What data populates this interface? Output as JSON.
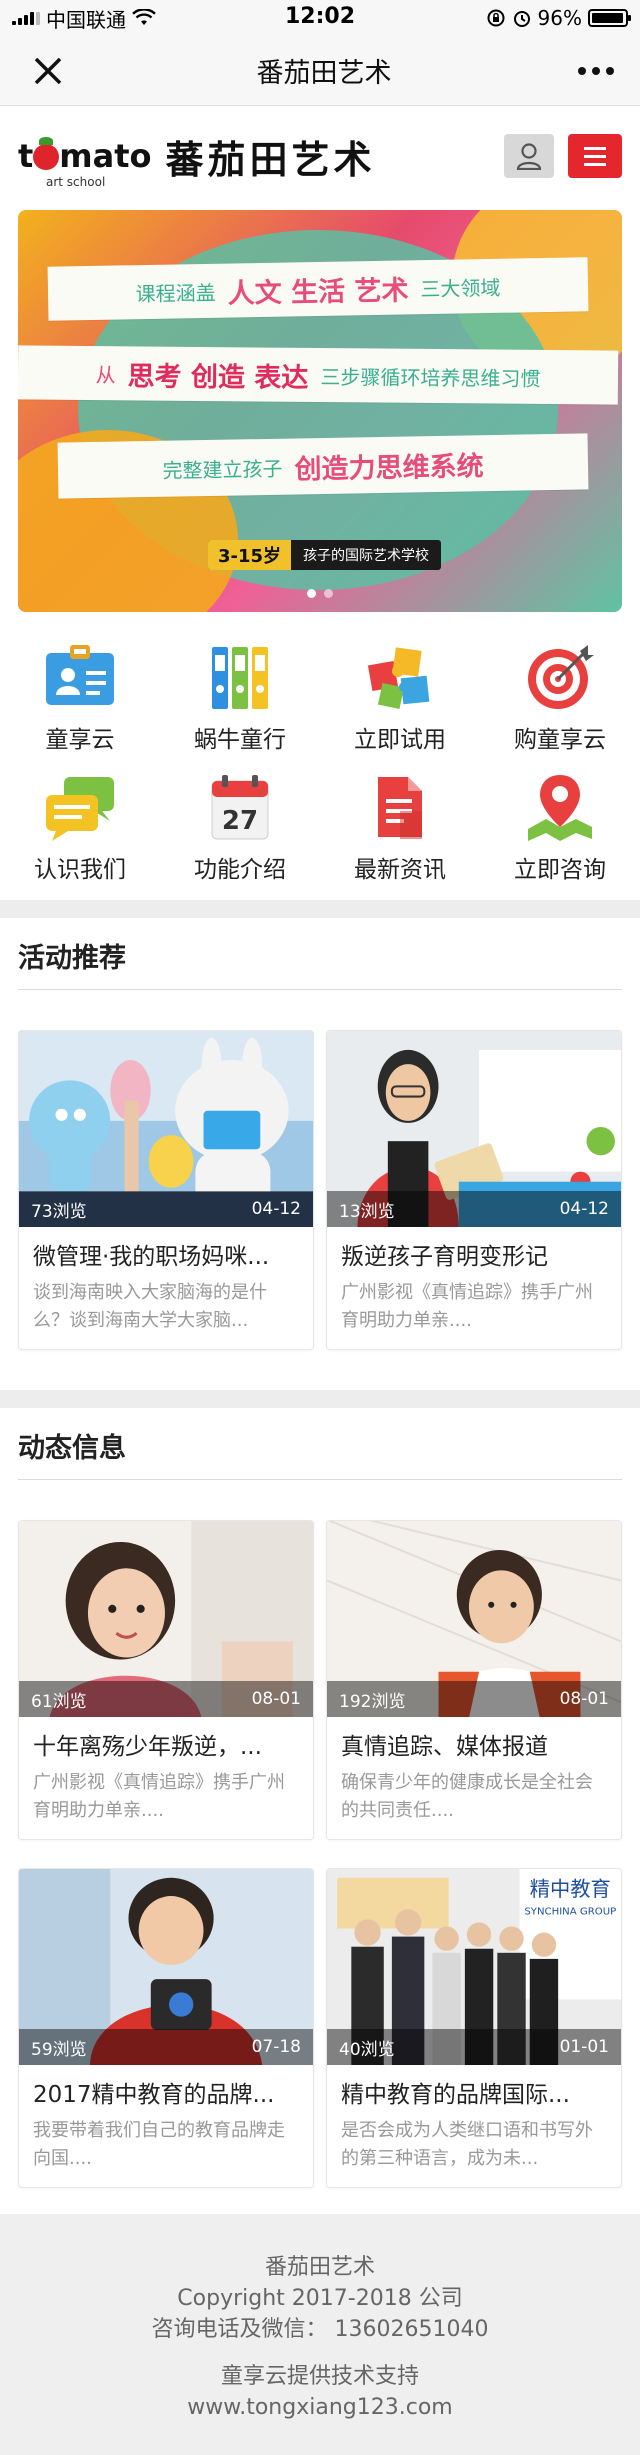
{
  "status_bar": {
    "carrier": "中国联通",
    "time": "12:02",
    "battery": "96%",
    "battery_level": 0.96
  },
  "nav": {
    "title": "番茄田艺术",
    "close_icon": "close-icon",
    "more_icon": "more-icon"
  },
  "header": {
    "logo_en": "tomato",
    "logo_sub": "art school",
    "logo_cn": "蕃茄田艺术",
    "user_icon": "user-icon",
    "menu_icon": "hamburger-menu-icon",
    "menu_color": "#e5262d"
  },
  "banner": {
    "line1_prefix": "课程涵盖",
    "line1_highlight": "人文 生活 艺术",
    "line1_suffix": "三大领域",
    "line2_prefix": "从",
    "line2_highlight": "思考 创造 表达",
    "line2_suffix": "三步骤循环培养思维习惯",
    "line3_prefix": "完整建立孩子",
    "line3_highlight": "创造力思维系统",
    "age": "3-15岁",
    "school": "孩子的国际艺术学校",
    "slides": 2,
    "active_slide": 0
  },
  "grid": [
    {
      "label": "童享云",
      "icon": "id-card-icon"
    },
    {
      "label": "蜗牛童行",
      "icon": "binders-icon"
    },
    {
      "label": "立即试用",
      "icon": "puzzle-icon"
    },
    {
      "label": "购童享云",
      "icon": "target-icon"
    },
    {
      "label": "认识我们",
      "icon": "chat-bubbles-icon"
    },
    {
      "label": "功能介绍",
      "icon": "calendar-icon"
    },
    {
      "label": "最新资讯",
      "icon": "document-icon"
    },
    {
      "label": "立即咨询",
      "icon": "map-pin-icon"
    }
  ],
  "calendar_day": "27",
  "activities": {
    "title": "活动推荐",
    "items": [
      {
        "views": "73浏览",
        "date": "04-12",
        "title": "微管理·我的职场妈咪...",
        "desc": "谈到海南映入大家脑海的是什么？谈到海南大学大家脑..."
      },
      {
        "views": "13浏览",
        "date": "04-12",
        "title": "叛逆孩子育明变形记",
        "desc": "广州影视《真情追踪》携手广州育明助力单亲...."
      }
    ]
  },
  "news": {
    "title": "动态信息",
    "items": [
      {
        "views": "61浏览",
        "date": "08-01",
        "title": "十年离殇少年叛逆，...",
        "desc": "广州影视《真情追踪》携手广州育明助力单亲...."
      },
      {
        "views": "192浏览",
        "date": "08-01",
        "title": "真情追踪、媒体报道",
        "desc": "确保青少年的健康成长是全社会的共同责任...."
      },
      {
        "views": "59浏览",
        "date": "07-18",
        "title": "2017精中教育的品牌...",
        "desc": "我要带着我们自己的教育品牌走向国...."
      },
      {
        "views": "40浏览",
        "date": "01-01",
        "title": "精中教育的品牌国际...",
        "desc": "是否会成为人类继口语和书写外的第三种语言，成为未..."
      }
    ]
  },
  "photo_text": {
    "signboard": "精中教育",
    "signboard_en": "SYNCHINA GROUP"
  },
  "footer": {
    "name": "番茄田艺术",
    "copyright": "Copyright 2017-2018 公司",
    "contact": "咨询电话及微信： 13602651040",
    "support": "童享云提供技术支持",
    "url": "www.tongxiang123.com"
  }
}
